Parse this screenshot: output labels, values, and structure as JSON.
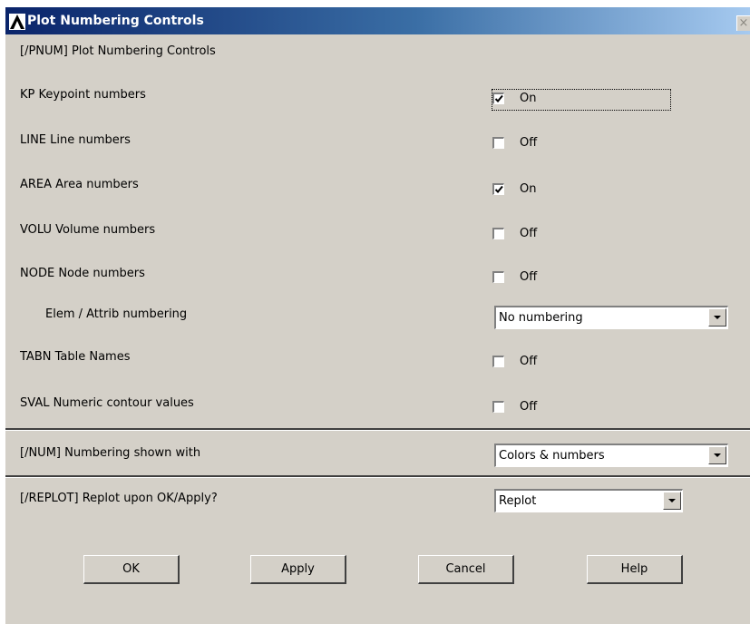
{
  "window": {
    "title": "Plot Numbering Controls",
    "close_glyph": "×"
  },
  "header": "[/PNUM]  Plot Numbering Controls",
  "options": [
    {
      "label": "KP    Keypoint numbers",
      "type": "checkbox",
      "checked": true,
      "state": "On"
    },
    {
      "label": "LINE  Line numbers",
      "type": "checkbox",
      "checked": false,
      "state": "Off"
    },
    {
      "label": "AREA  Area numbers",
      "type": "checkbox",
      "checked": true,
      "state": "On"
    },
    {
      "label": "VOLU  Volume numbers",
      "type": "checkbox",
      "checked": false,
      "state": "Off"
    },
    {
      "label": "NODE  Node numbers",
      "type": "checkbox",
      "checked": false,
      "state": "Off"
    },
    {
      "label": "Elem / Attrib numbering",
      "type": "select",
      "value": "No numbering"
    },
    {
      "label": "TABN  Table Names",
      "type": "checkbox",
      "checked": false,
      "state": "Off"
    },
    {
      "label": "SVAL  Numeric contour values",
      "type": "checkbox",
      "checked": false,
      "state": "Off"
    }
  ],
  "num": {
    "label": "[/NUM]  Numbering shown with",
    "value": "Colors & numbers"
  },
  "replot": {
    "label": "[/REPLOT] Replot upon OK/Apply?",
    "value": "Replot"
  },
  "buttons": {
    "ok": "OK",
    "apply": "Apply",
    "cancel": "Cancel",
    "help": "Help"
  },
  "icons": {
    "app_logo": "ansys-logo-icon",
    "close": "close-icon",
    "checkmark": "checkmark-icon",
    "dropdown": "dropdown-arrow-icon"
  }
}
